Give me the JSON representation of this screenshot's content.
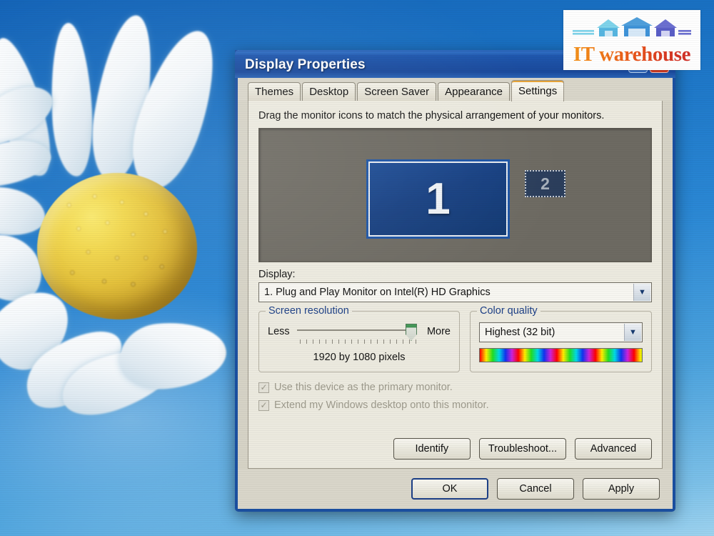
{
  "desktop": {
    "wallpaper_description": "daisy flower on blue sky",
    "sky_color": "#1a72c4",
    "petal_color": "#ffffff",
    "disc_color": "#e3bf35"
  },
  "watermark": {
    "text": "IT warehouse",
    "houses_icon": "warehouse-houses-icon",
    "text_gradient_start": "#f39019",
    "text_gradient_end": "#cf2f28",
    "house_colors": [
      "#5fc4e8",
      "#3f93d8",
      "#6b6fd0"
    ],
    "background": "#fefefe"
  },
  "dialog": {
    "title": "Display Properties",
    "titlebar_color": "#1c4fa3",
    "border_color": "#1a4fa0",
    "window_buttons": [
      {
        "name": "help-button",
        "glyph": "?"
      },
      {
        "name": "close-button",
        "glyph": "✕"
      }
    ],
    "tabs": [
      {
        "label": "Themes",
        "active": false
      },
      {
        "label": "Desktop",
        "active": false
      },
      {
        "label": "Screen Saver",
        "active": false
      },
      {
        "label": "Appearance",
        "active": false
      },
      {
        "label": "Settings",
        "active": true
      }
    ],
    "settings": {
      "hint": "Drag the monitor icons to match the physical arrangement of your monitors.",
      "monitors": [
        {
          "number": "1",
          "selected": true
        },
        {
          "number": "2",
          "selected": false
        }
      ],
      "display_label": "Display:",
      "display_value": "1. Plug and Play Monitor on Intel(R) HD Graphics",
      "screen_resolution": {
        "group_title": "Screen resolution",
        "less_label": "Less",
        "more_label": "More",
        "value": "1920 by 1080 pixels",
        "slider_position_percent": 100
      },
      "color_quality": {
        "group_title": "Color quality",
        "value": "Highest (32 bit)"
      },
      "checkboxes": [
        {
          "label": "Use this device as the primary monitor.",
          "checked": true,
          "disabled": true
        },
        {
          "label": "Extend my Windows desktop onto this monitor.",
          "checked": true,
          "disabled": true
        }
      ],
      "action_buttons": [
        {
          "label": "Identify"
        },
        {
          "label": "Troubleshoot..."
        },
        {
          "label": "Advanced"
        }
      ]
    },
    "dialog_buttons": [
      {
        "label": "OK",
        "default": true
      },
      {
        "label": "Cancel",
        "default": false
      },
      {
        "label": "Apply",
        "default": false
      }
    ]
  }
}
